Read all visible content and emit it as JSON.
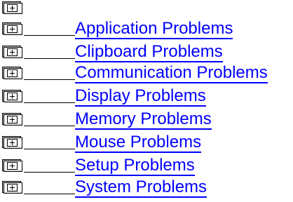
{
  "colors": {
    "link": "#0000ff",
    "book_fill": "#ffffff",
    "book_stroke": "#000000",
    "book_tab": "#c0c0c0"
  },
  "root": {
    "icon": "book-closed-icon"
  },
  "topics": [
    {
      "label": "Application Problems",
      "icon": "book-closed-icon"
    },
    {
      "label": "Clipboard Problems",
      "icon": "book-closed-icon"
    },
    {
      "label": "Communication Problems",
      "icon": "book-closed-icon"
    },
    {
      "label": "Display Problems",
      "icon": "book-closed-icon"
    },
    {
      "label": "Memory Problems",
      "icon": "book-closed-icon"
    },
    {
      "label": "Mouse Problems",
      "icon": "book-closed-icon"
    },
    {
      "label": "Setup Problems",
      "icon": "book-closed-icon"
    },
    {
      "label": "System Problems",
      "icon": "book-closed-icon"
    }
  ]
}
